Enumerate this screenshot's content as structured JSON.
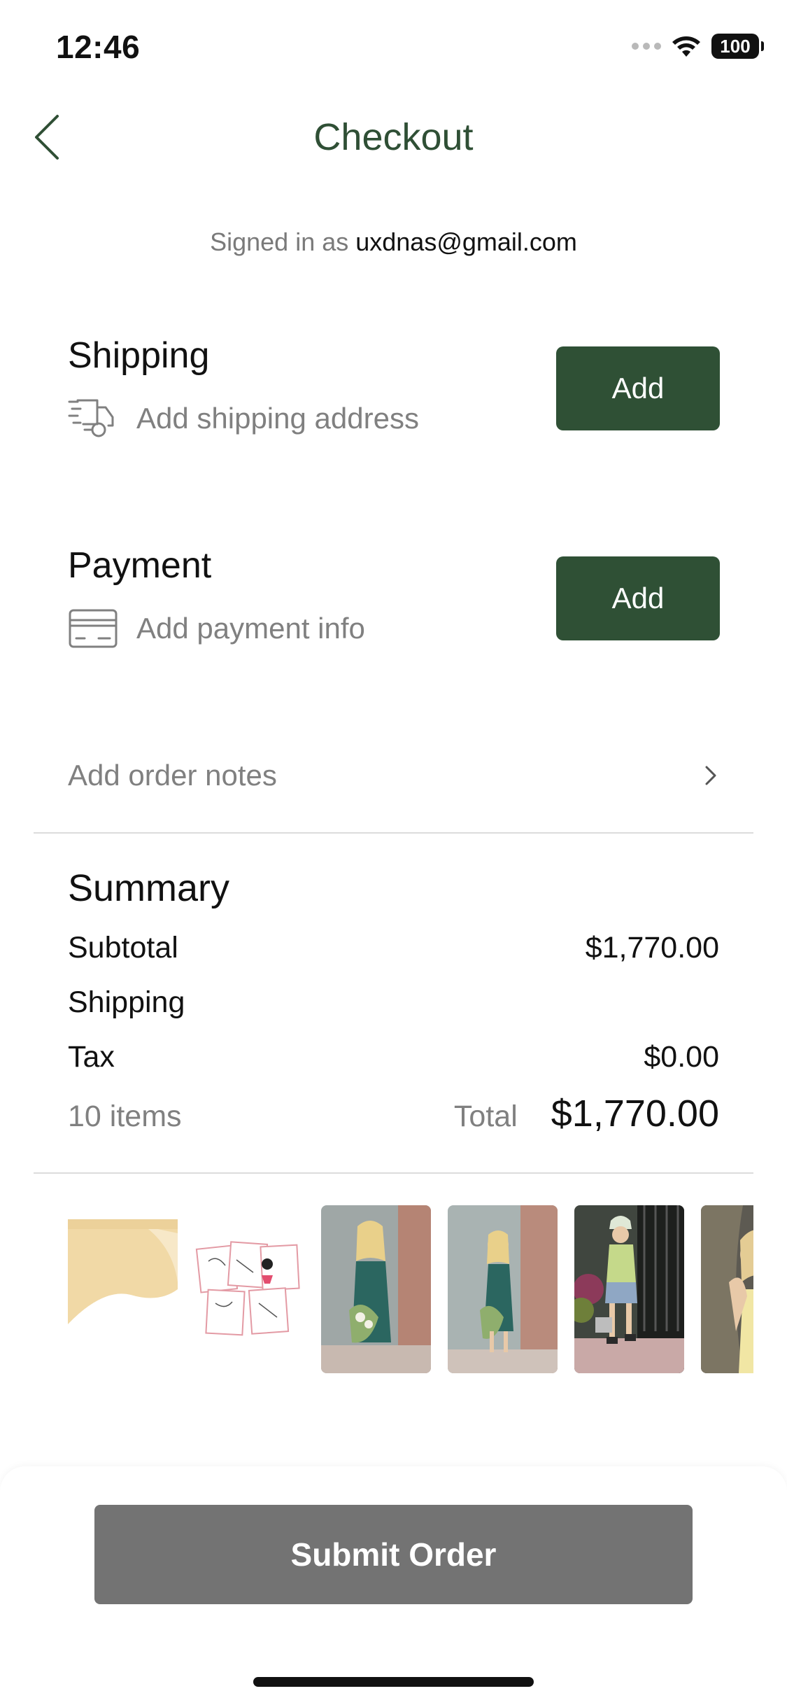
{
  "status_bar": {
    "time": "12:46",
    "battery": "100"
  },
  "header": {
    "title": "Checkout",
    "back_icon": "chevron-left-icon"
  },
  "account": {
    "prefix": "Signed in as",
    "email": "uxdnas@gmail.com"
  },
  "shipping": {
    "title": "Shipping",
    "prompt": "Add shipping address",
    "button": "Add",
    "icon": "delivery-truck-icon"
  },
  "payment": {
    "title": "Payment",
    "prompt": "Add payment info",
    "button": "Add",
    "icon": "credit-card-icon"
  },
  "notes": {
    "label": "Add order notes",
    "icon": "chevron-right-icon"
  },
  "summary": {
    "title": "Summary",
    "rows": [
      {
        "label": "Subtotal",
        "value": "$1,770.00"
      },
      {
        "label": "Shipping",
        "value": ""
      },
      {
        "label": "Tax",
        "value": "$0.00"
      }
    ],
    "items_count": "10 items",
    "total_label": "Total",
    "total_value": "$1,770.00"
  },
  "thumbnails": [
    {
      "name": "tablecloth-thumbnail"
    },
    {
      "name": "greeting-cards-thumbnail"
    },
    {
      "name": "green-dress-thumbnail-1"
    },
    {
      "name": "green-dress-thumbnail-2"
    },
    {
      "name": "outfit-thumbnail"
    },
    {
      "name": "yellow-top-thumbnail"
    }
  ],
  "footer": {
    "submit_label": "Submit Order"
  },
  "colors": {
    "accent": "#2f5035",
    "title": "#2f4f35",
    "submit": "#737373",
    "muted": "#808080"
  }
}
